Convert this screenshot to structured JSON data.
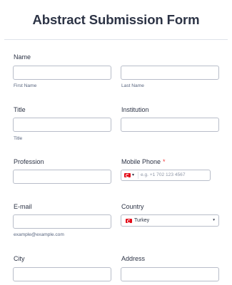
{
  "form": {
    "title": "Abstract Submission Form"
  },
  "fields": {
    "name": {
      "label": "Name",
      "first_sublabel": "First Name",
      "last_sublabel": "Last Name"
    },
    "title": {
      "label": "Title",
      "sublabel": "Title"
    },
    "institution": {
      "label": "Institution"
    },
    "profession": {
      "label": "Profession"
    },
    "mobile_phone": {
      "label": "Mobile Phone",
      "required_mark": "*",
      "placeholder": "e.g. +1 702 123 4567",
      "country_flag": "turkey-flag-icon"
    },
    "email": {
      "label": "E-mail",
      "sublabel": "example@example.com"
    },
    "country": {
      "label": "Country",
      "selected": "Turkey",
      "flag": "turkey-flag-icon"
    },
    "city": {
      "label": "City"
    },
    "address": {
      "label": "Address"
    }
  },
  "icons": {
    "dropdown_caret": "▾"
  },
  "colors": {
    "required": "#f23a3c",
    "text": "#2c3345",
    "border": "#b8bdc9",
    "flag_red": "#e30a17"
  }
}
